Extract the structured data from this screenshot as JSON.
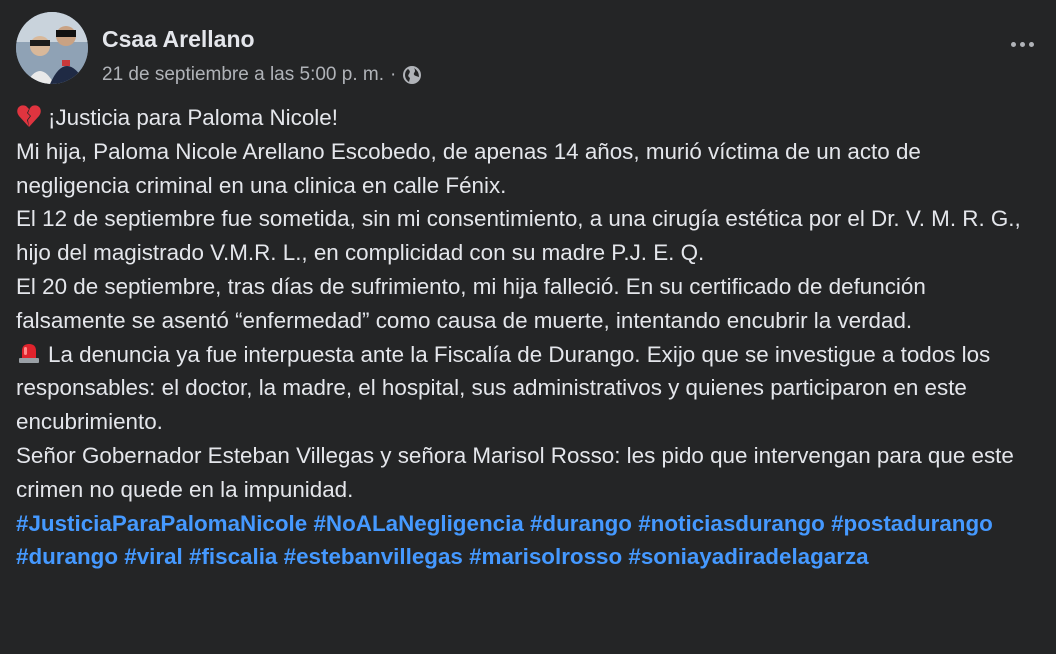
{
  "post": {
    "author": "Csaa Arellano",
    "timestamp": "21 de septiembre a las 5:00 p. m.",
    "separator": "·",
    "privacy_icon": "globe-icon",
    "menu_icon": "more-options-icon"
  },
  "content": {
    "title": "¡Justicia para Paloma Nicole!",
    "title_emoji": "broken-heart-icon",
    "p1": "Mi hija, Paloma Nicole Arellano Escobedo, de apenas 14 años, murió víctima de un acto de negligencia criminal en una clinica en calle Fénix.",
    "p2": "El 12 de septiembre fue sometida, sin mi consentimiento, a una cirugía estética por el Dr. V. M. R. G., hijo del magistrado V.M.R. L., en complicidad con su madre P.J. E. Q.",
    "p3": "El 20 de septiembre, tras días de sufrimiento, mi hija falleció. En su certificado de defunción falsamente se asentó “enfermedad” como causa de muerte, intentando encubrir la verdad.",
    "p4_emoji": "siren-icon",
    "p4": "La denuncia ya fue interpuesta ante la Fiscalía de Durango. Exijo que se investigue a todos los responsables: el doctor, la madre, el hospital, sus administrativos y quienes participaron en este encubrimiento.",
    "p5": "Señor Gobernador Esteban Villegas y señora Marisol Rosso: les pido que intervengan para que este crimen no quede en la impunidad."
  },
  "hashtags": [
    "#JusticiaParaPalomaNicole",
    "#NoALaNegligencia",
    "#durango",
    "#noticiasdurango",
    "#postadurango",
    "#durango",
    "#viral",
    "#fiscalia",
    "#estebanvillegas",
    "#marisolrosso",
    "#soniayadiradelagarza"
  ],
  "colors": {
    "background": "#242526",
    "text": "#e4e6eb",
    "secondary_text": "#b0b3b8",
    "hashtag": "#4599ff",
    "siren": "#e0232c"
  }
}
